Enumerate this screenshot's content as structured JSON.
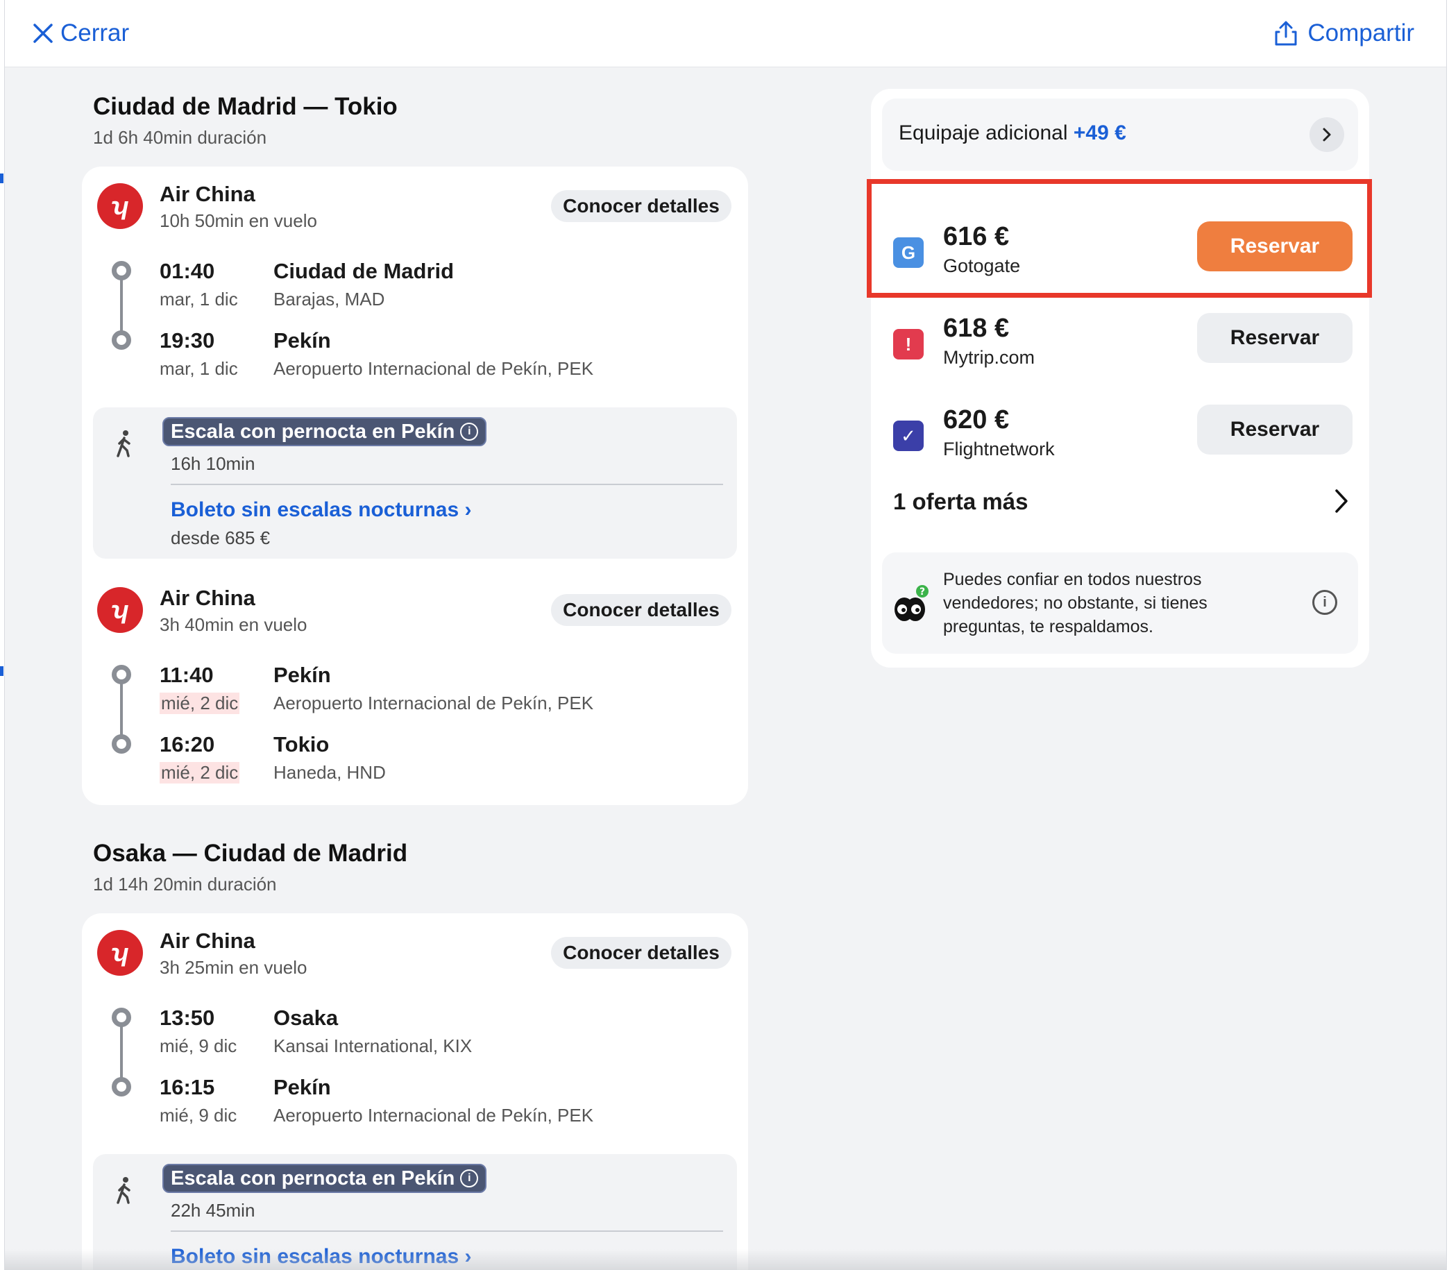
{
  "header": {
    "close_label": "Cerrar",
    "share_label": "Compartir"
  },
  "outbound": {
    "title": "Ciudad de Madrid — Tokio",
    "duration": "1d 6h 40min duración",
    "legs": [
      {
        "airline": "Air China",
        "flight_time": "10h 50min en vuelo",
        "details_label": "Conocer detalles",
        "depart_time": "01:40",
        "depart_date": "mar, 1 dic",
        "depart_city": "Ciudad de Madrid",
        "depart_airport": "Barajas, MAD",
        "arrive_time": "19:30",
        "arrive_date": "mar, 1 dic",
        "arrive_city": "Pekín",
        "arrive_airport": "Aeropuerto Internacional de Pekín, PEK"
      },
      {
        "airline": "Air China",
        "flight_time": "3h 40min en vuelo",
        "details_label": "Conocer detalles",
        "depart_time": "11:40",
        "depart_date": "mié, 2 dic",
        "depart_city": "Pekín",
        "depart_airport": "Aeropuerto Internacional de Pekín, PEK",
        "arrive_time": "16:20",
        "arrive_date": "mié, 2 dic",
        "arrive_city": "Tokio",
        "arrive_airport": "Haneda, HND"
      }
    ],
    "layover": {
      "badge": "Escala con pernocta en Pekín",
      "duration": "16h 10min",
      "link": "Boleto sin escalas nocturnas",
      "from": "desde 685 €"
    }
  },
  "return": {
    "title": "Osaka — Ciudad de Madrid",
    "duration": "1d 14h 20min duración",
    "legs": [
      {
        "airline": "Air China",
        "flight_time": "3h 25min en vuelo",
        "details_label": "Conocer detalles",
        "depart_time": "13:50",
        "depart_date": "mié, 9 dic",
        "depart_city": "Osaka",
        "depart_airport": "Kansai International, KIX",
        "arrive_time": "16:15",
        "arrive_date": "mié, 9 dic",
        "arrive_city": "Pekín",
        "arrive_airport": "Aeropuerto Internacional de Pekín, PEK"
      }
    ],
    "layover": {
      "badge": "Escala con pernocta en Pekín",
      "duration": "22h 45min",
      "link": "Boleto sin escalas nocturnas"
    }
  },
  "sidebar": {
    "baggage_label": "Equipaje adicional",
    "baggage_amount": "+49 €",
    "offers": [
      {
        "price": "616 €",
        "vendor": "Gotogate",
        "button": "Reservar",
        "logo_color": "#4a90e2"
      },
      {
        "price": "618 €",
        "vendor": "Mytrip.com",
        "button": "Reservar",
        "logo_color": "#e23b4e"
      },
      {
        "price": "620 €",
        "vendor": "Flightnetwork",
        "button": "Reservar",
        "logo_color": "#3b3fa8"
      }
    ],
    "more_offers": "1 oferta más",
    "trust_text": "Puedes confiar en todos nuestros vendedores; no obstante, si tienes preguntas, te respaldamos."
  },
  "colors": {
    "accent": "#1a5fd6",
    "book_primary": "#ef7e3f",
    "highlight": "#e8382a",
    "airline_logo": "#d8262a"
  }
}
